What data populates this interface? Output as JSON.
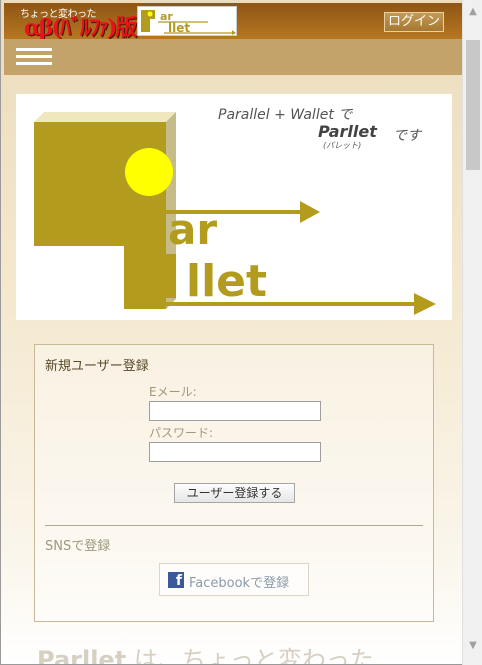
{
  "header": {
    "brand_small": "ちょっと変わった",
    "brand_big": "αβ(ﾊﾞﾙﾌｧ)版",
    "logo_text_top": "ar",
    "logo_text_bottom": "llet",
    "login_label": "ログイン"
  },
  "hero": {
    "tagline_1": "Parallel + Wallet で",
    "tagline_brand": "Parllet",
    "tagline_desu": "です",
    "tagline_reading": "(パレット)",
    "logo_ar": "ar",
    "logo_llet": "llet"
  },
  "register": {
    "title": "新規ユーザー登録",
    "email_label": "Eメール:",
    "email_value": "",
    "password_label": "パスワード:",
    "password_value": "",
    "submit_label": "ユーザー登録する",
    "sns_title": "SNSで登録",
    "facebook_icon_letter": "f",
    "facebook_label": "Facebookで登録"
  },
  "footer_heading": {
    "brand": "Parllet",
    "rest": " は、ちょっと変わった"
  },
  "colors": {
    "header_brown": "#8e5514",
    "nav_tan": "#c4a36a",
    "logo_olive": "#b39b1e",
    "logo_yellow": "#ffff00",
    "facebook_blue": "#3b5998"
  }
}
